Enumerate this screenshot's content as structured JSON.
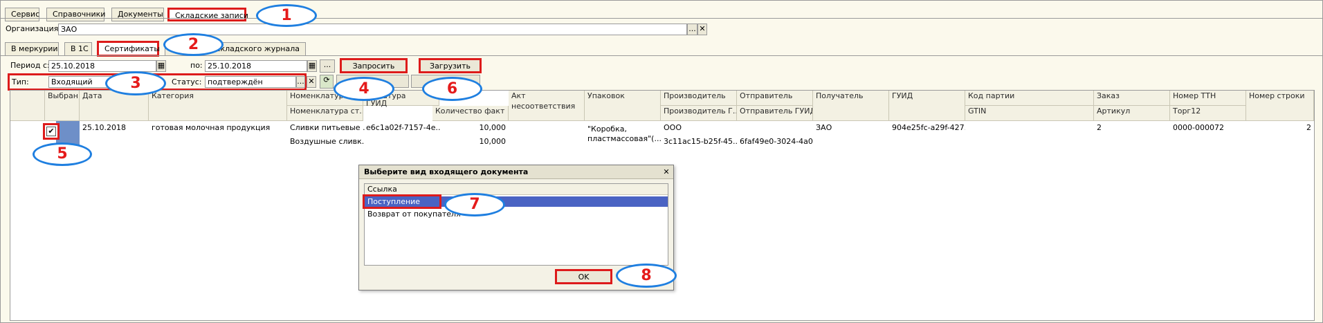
{
  "top_tabs": [
    "Сервис",
    "Справочники",
    "Документы",
    "Складские записи"
  ],
  "org": {
    "label": "Организация:",
    "value": "ЗАО"
  },
  "inner_tabs": [
    "В меркурии",
    "В 1С",
    "Сертификаты",
    "... й складского журнала"
  ],
  "filters": {
    "period_from_label": "Период с:",
    "period_from": "25.10.2018",
    "period_to_label": "по:",
    "period_to": "25.10.2018",
    "type_label": "Тип:",
    "type_value": "Входящий",
    "status_label": "Статус:",
    "status_value": "подтверждён"
  },
  "buttons": {
    "request": "Запросить",
    "load": "Загрузить",
    "act_partial": "Ак",
    "ellipsis": "...",
    "clear": "✕"
  },
  "grid": {
    "headers": {
      "selected": "Выбран",
      "date": "Дата",
      "category": "Категория",
      "nomenclature": "Номенклатура",
      "nomenclature_st": "Номенклатура ст...",
      "nomenclature_b": "...клатура",
      "guid": "ГУИД",
      "qty_fact": "Количество факт",
      "act_line1": "Акт",
      "act_line2": "несоответствия",
      "pack": "Упаковок",
      "producer": "Производитель",
      "producer_g": "Производитель Г...",
      "sender": "Отправитель",
      "sender_guid": "Отправитель ГУИД",
      "receiver": "Получатель",
      "guid2": "ГУИД",
      "batch": "Код партии",
      "gtin": "GTIN",
      "order": "Заказ",
      "article": "Артикул",
      "ttn": "Номер ТТН",
      "torg": "Торг12",
      "line_no": "Номер строки"
    },
    "row": {
      "date": "25.10.2018",
      "category": "готовая молочная продукция",
      "nom1": "Сливки питьевые ...",
      "nom2": "Воздушные сливк...",
      "guid": "e6c1a02f-7157-4e...",
      "qty1": "10,000",
      "qty2": "10,000",
      "pack1": "\"Коробка,",
      "pack2": "пластмассовая\"(...",
      "producer": "ООО",
      "producer_guid": "3c11ac15-b25f-45...",
      "sender_guid": "6faf49e0-3024-4a0...",
      "receiver": "ЗАО",
      "guid2": "904e25fc-a29f-427...",
      "order": "2",
      "ttn": "0000-000072",
      "line_no": "2"
    }
  },
  "dialog": {
    "title": "Выберите вид входящего документа",
    "close": "✕",
    "column": "Ссылка",
    "items": [
      "Поступление",
      "Возврат от покупателя"
    ],
    "ok": "OK"
  },
  "callouts": [
    "1",
    "2",
    "3",
    "4",
    "5",
    "6",
    "7",
    "8"
  ]
}
